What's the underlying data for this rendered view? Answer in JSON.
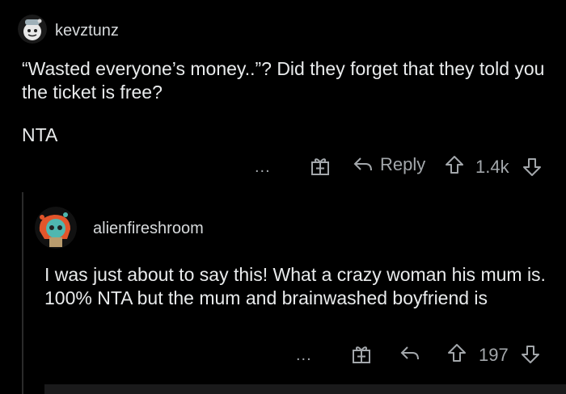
{
  "comments": [
    {
      "username": "kevztunz",
      "body": "“Wasted everyone’s money..”? Did they forget that they told you the ticket is free?",
      "body2": "NTA",
      "more_label": "...",
      "reply_label": "Reply",
      "votes": "1.4k",
      "icons": [
        "more-icon",
        "award-icon",
        "reply-icon",
        "upvote-icon",
        "downvote-icon"
      ]
    },
    {
      "username": "alienfireshroom",
      "body": "I was just about to say this! What a crazy woman his mum is. 100% NTA but the mum and brainwashed boyfriend is",
      "more_label": "...",
      "votes": "197",
      "icons": [
        "more-icon",
        "award-icon",
        "reply-icon",
        "upvote-icon",
        "downvote-icon"
      ]
    }
  ],
  "colors": {
    "background": "#000000",
    "text": "#e9ebec",
    "muted": "#a3a7ab"
  }
}
